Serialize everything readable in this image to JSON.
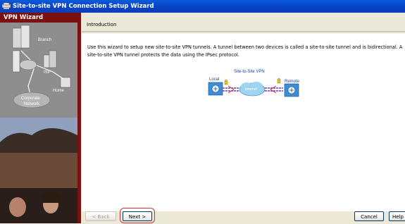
{
  "window": {
    "title": "Site-to-site VPN Connection Setup Wizard"
  },
  "sidebar": {
    "title": "VPN Wizard",
    "branch_label": "Branch",
    "isp_label": "ISP",
    "home_label": "Home",
    "corporate_line1": "Corporate",
    "corporate_line2": "Network"
  },
  "section": {
    "title": "Introduction"
  },
  "description": "Use this wizard to setup new site-to-site VPN tunnels. A tunnel between two devices is called a site-to-site tunnel and is bidirectional. A site-to-site VPN tunnel protects the data using the IPsec protocol.",
  "diagram": {
    "title": "Site-to-Site VPN",
    "local_label": "Local",
    "remote_label": "Remote",
    "cloud_label": "Internet"
  },
  "buttons": {
    "back": "< Back",
    "next": "Next >",
    "cancel": "Cancel",
    "help": "Help"
  }
}
